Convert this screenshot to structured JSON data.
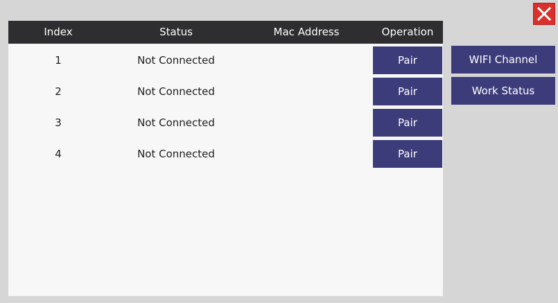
{
  "close_icon": "close-x-icon",
  "colors": {
    "background": "#d6d6d6",
    "header": "#2e2e30",
    "button": "#3d3c7a",
    "close": "#d9302c"
  },
  "table": {
    "headers": {
      "index": "Index",
      "status": "Status",
      "mac": "Mac Address",
      "operation": "Operation"
    },
    "rows": [
      {
        "index": "1",
        "status": "Not Connected",
        "mac": "",
        "action": "Pair"
      },
      {
        "index": "2",
        "status": "Not Connected",
        "mac": "",
        "action": "Pair"
      },
      {
        "index": "3",
        "status": "Not Connected",
        "mac": "",
        "action": "Pair"
      },
      {
        "index": "4",
        "status": "Not Connected",
        "mac": "",
        "action": "Pair"
      }
    ]
  },
  "side_buttons": {
    "wifi_channel": "WIFI Channel",
    "work_status": "Work Status"
  }
}
